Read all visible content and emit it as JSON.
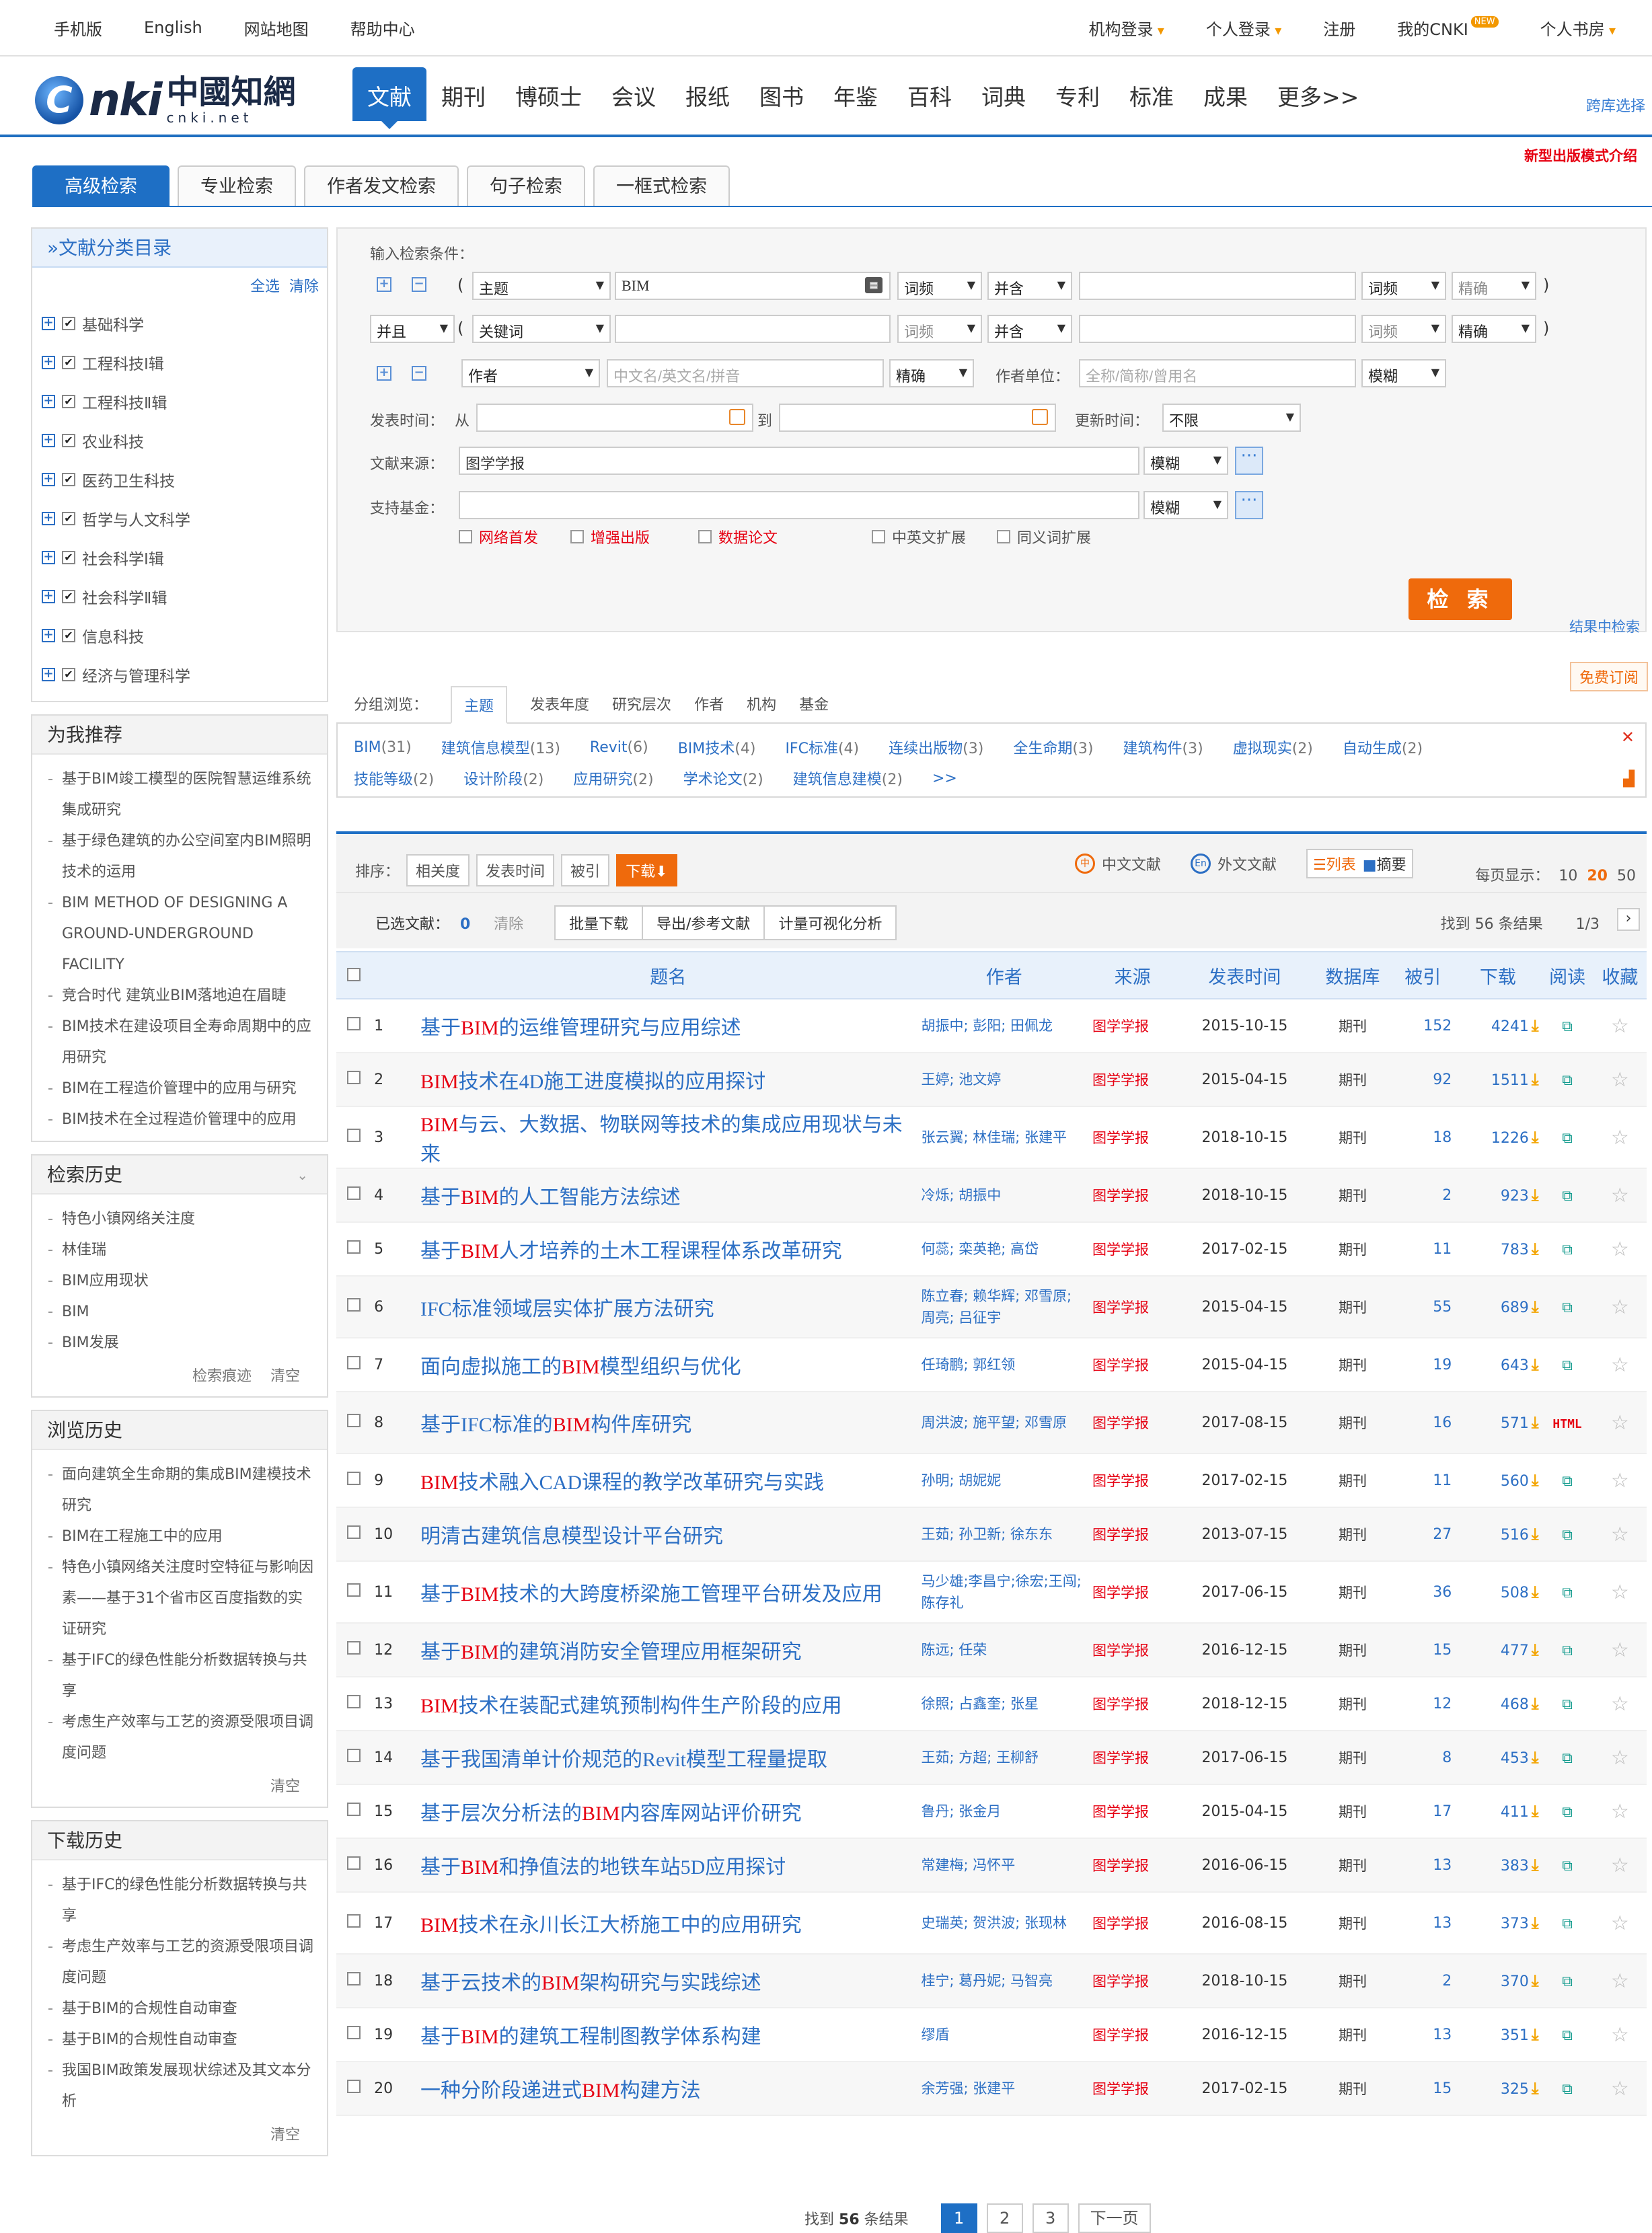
{
  "topbar": {
    "left": [
      "手机版",
      "English",
      "网站地图",
      "帮助中心"
    ],
    "right": [
      "机构登录",
      "个人登录",
      "注册",
      "我的CNKI",
      "个人书房"
    ],
    "new_badge": "NEW"
  },
  "logo": {
    "mark": "C",
    "text": "nki",
    "cn": "中國知網",
    "en": "cnki.net"
  },
  "nav": [
    "文献",
    "期刊",
    "博硕士",
    "会议",
    "报纸",
    "图书",
    "年鉴",
    "百科",
    "词典",
    "专利",
    "标准",
    "成果",
    "更多>>"
  ],
  "cross_select": "跨库选择",
  "new_pub": "新型出版模式介绍",
  "search_tabs": [
    "高级检索",
    "专业检索",
    "作者发文检索",
    "句子检索",
    "一框式检索"
  ],
  "sidebar": {
    "catalog_title": "»文献分类目录",
    "select_all": "全选",
    "clear": "清除",
    "categories": [
      "基础科学",
      "工程科技Ⅰ辑",
      "工程科技Ⅱ辑",
      "农业科技",
      "医药卫生科技",
      "哲学与人文科学",
      "社会科学Ⅰ辑",
      "社会科学Ⅱ辑",
      "信息科技",
      "经济与管理科学"
    ],
    "recommend_title": "为我推荐",
    "recommend": [
      "基于BIM竣工模型的医院智慧运维系统集成研究",
      "基于绿色建筑的办公空间室内BIM照明技术的运用",
      "BIM METHOD OF DESIGNING A GROUND-UNDERGROUND FACILITY",
      "竞合时代 建筑业BIM落地迫在眉睫",
      "BIM技术在建设项目全寿命周期中的应用研究",
      "BIM在工程造价管理中的应用与研究",
      "BIM技术在全过程造价管理中的应用"
    ],
    "search_history_title": "检索历史",
    "search_history": [
      "特色小镇网络关注度",
      "林佳瑞",
      "BIM应用现状",
      "BIM",
      "BIM发展"
    ],
    "search_history_trace": "检索痕迹",
    "search_history_clear": "清空",
    "browse_history_title": "浏览历史",
    "browse_history": [
      "面向建筑全生命期的集成BIM建模技术研究",
      "BIM在工程施工中的应用",
      "特色小镇网络关注度时空特征与影响因素——基于31个省市区百度指数的实证研究",
      "基于IFC的绿色性能分析数据转换与共享",
      "考虑生产效率与工艺的资源受限项目调度问题"
    ],
    "browse_history_clear": "清空",
    "download_history_title": "下载历史",
    "download_history": [
      "基于IFC的绿色性能分析数据转换与共享",
      "考虑生产效率与工艺的资源受限项目调度问题",
      "基于BIM的合规性自动审查",
      "基于BIM的合规性自动审查",
      "我国BIM政策发展现状综述及其文本分析"
    ],
    "download_history_clear": "清空"
  },
  "form": {
    "input_label": "输入检索条件：",
    "row1": {
      "field": "主题",
      "value": "BIM",
      "freq": "词频",
      "logic": "并含",
      "freq2": "词频",
      "match": "精确"
    },
    "row2": {
      "op": "并且",
      "field": "关键词",
      "freq": "词频",
      "logic": "并含",
      "freq2": "词频",
      "match": "精确"
    },
    "row3": {
      "field": "作者",
      "author_placeholder": "中文名/英文名/拼音",
      "match": "精确",
      "unit_label": "作者单位：",
      "unit_placeholder": "全称/简称/曾用名",
      "unit_match": "模糊"
    },
    "time_label": "发表时间：",
    "from": "从",
    "to": "到",
    "update_label": "更新时间：",
    "update_value": "不限",
    "source_label": "文献来源：",
    "source_value": "图学学报",
    "source_match": "模糊",
    "fund_label": "支持基金：",
    "fund_match": "模糊",
    "options": [
      "网络首发",
      "增强出版",
      "数据论文",
      "中英文扩展",
      "同义词扩展"
    ],
    "search_button": "检 索",
    "in_results": "结果中检索",
    "free_sub": "免费订阅",
    "paren_open": "(",
    "paren_close": ")",
    "dots": "···"
  },
  "group": {
    "label": "分组浏览：",
    "tabs": [
      "主题",
      "发表年度",
      "研究层次",
      "作者",
      "机构",
      "基金"
    ],
    "items": [
      {
        "name": "BIM",
        "count": "(31)"
      },
      {
        "name": "建筑信息模型",
        "count": "(13)"
      },
      {
        "name": "Revit",
        "count": "(6)"
      },
      {
        "name": "BIM技术",
        "count": "(4)"
      },
      {
        "name": "IFC标准",
        "count": "(4)"
      },
      {
        "name": "连续出版物",
        "count": "(3)"
      },
      {
        "name": "全生命期",
        "count": "(3)"
      },
      {
        "name": "建筑构件",
        "count": "(3)"
      },
      {
        "name": "虚拟现实",
        "count": "(2)"
      },
      {
        "name": "自动生成",
        "count": "(2)"
      },
      {
        "name": "技能等级",
        "count": "(2)"
      },
      {
        "name": "设计阶段",
        "count": "(2)"
      },
      {
        "name": "应用研究",
        "count": "(2)"
      },
      {
        "name": "学术论文",
        "count": "(2)"
      },
      {
        "name": "建筑信息建模",
        "count": "(2)"
      }
    ],
    "more": ">>",
    "close": "✕"
  },
  "results_bar": {
    "sort_label": "排序：",
    "sorts": [
      "相关度",
      "发表时间",
      "被引",
      "下载"
    ],
    "cn": "中文文献",
    "en": "外文文献",
    "view_list": "列表",
    "view_abstract": "摘要",
    "per_page_label": "每页显示：",
    "per_page": [
      "10",
      "20",
      "50"
    ],
    "selected_label": "已选文献：",
    "selected_count": "0",
    "clear": "清除",
    "ops": [
      "批量下载",
      "导出/参考文献",
      "计量可视化分析"
    ],
    "found": "找到 56 条结果",
    "page": "1/3",
    "next": "›"
  },
  "table": {
    "headers": [
      "题名",
      "作者",
      "来源",
      "发表时间",
      "数据库",
      "被引",
      "下载",
      "阅读",
      "收藏"
    ],
    "rows": [
      {
        "no": "1",
        "pre": "基于",
        "hl": "BIM",
        "post": "的运维管理研究与应用综述",
        "authors": "胡振中; 彭阳; 田佩龙",
        "source": "图学学报",
        "date": "2015-10-15",
        "db": "期刊",
        "cited": "152",
        "dl": "4241"
      },
      {
        "no": "2",
        "pre": "",
        "hl": "BIM",
        "post": "技术在4D施工进度模拟的应用探讨",
        "authors": "王婷; 池文婷",
        "source": "图学学报",
        "date": "2015-04-15",
        "db": "期刊",
        "cited": "92",
        "dl": "1511"
      },
      {
        "no": "3",
        "pre": "",
        "hl": "BIM",
        "post": "与云、大数据、物联网等技术的集成应用现状与未来",
        "authors": "张云翼; 林佳瑞; 张建平",
        "source": "图学学报",
        "date": "2018-10-15",
        "db": "期刊",
        "cited": "18",
        "dl": "1226"
      },
      {
        "no": "4",
        "pre": "基于",
        "hl": "BIM",
        "post": "的人工智能方法综述",
        "authors": "冷烁; 胡振中",
        "source": "图学学报",
        "date": "2018-10-15",
        "db": "期刊",
        "cited": "2",
        "dl": "923"
      },
      {
        "no": "5",
        "pre": "基于",
        "hl": "BIM",
        "post": "人才培养的土木工程课程体系改革研究",
        "authors": "何蕊; 栾英艳; 高岱",
        "source": "图学学报",
        "date": "2017-02-15",
        "db": "期刊",
        "cited": "11",
        "dl": "783"
      },
      {
        "no": "6",
        "pre": "IFC标准领域层实体扩展方法研究",
        "hl": "",
        "post": "",
        "authors": "陈立春; 赖华辉; 邓雪原; 周亮; 吕征宇",
        "source": "图学学报",
        "date": "2015-04-15",
        "db": "期刊",
        "cited": "55",
        "dl": "689"
      },
      {
        "no": "7",
        "pre": "面向虚拟施工的",
        "hl": "BIM",
        "post": "模型组织与优化",
        "authors": "任琦鹏; 郭红领",
        "source": "图学学报",
        "date": "2015-04-15",
        "db": "期刊",
        "cited": "19",
        "dl": "643"
      },
      {
        "no": "8",
        "pre": "基于IFC标准的",
        "hl": "BIM",
        "post": "构件库研究",
        "authors": "周洪波; 施平望; 邓雪原",
        "source": "图学学报",
        "date": "2017-08-15",
        "db": "期刊",
        "cited": "16",
        "dl": "571",
        "html": "HTML"
      },
      {
        "no": "9",
        "pre": "",
        "hl": "BIM",
        "post": "技术融入CAD课程的教学改革研究与实践",
        "authors": "孙明; 胡妮妮",
        "source": "图学学报",
        "date": "2017-02-15",
        "db": "期刊",
        "cited": "11",
        "dl": "560"
      },
      {
        "no": "10",
        "pre": "明清古建筑信息模型设计平台研究",
        "hl": "",
        "post": "",
        "authors": "王茹; 孙卫新; 徐东东",
        "source": "图学学报",
        "date": "2013-07-15",
        "db": "期刊",
        "cited": "27",
        "dl": "516"
      },
      {
        "no": "11",
        "pre": "基于",
        "hl": "BIM",
        "post": "技术的大跨度桥梁施工管理平台研发及应用",
        "authors": "马少雄;李昌宁;徐宏;王闯;陈存礼",
        "source": "图学学报",
        "date": "2017-06-15",
        "db": "期刊",
        "cited": "36",
        "dl": "508"
      },
      {
        "no": "12",
        "pre": "基于",
        "hl": "BIM",
        "post": "的建筑消防安全管理应用框架研究",
        "authors": "陈远; 任荣",
        "source": "图学学报",
        "date": "2016-12-15",
        "db": "期刊",
        "cited": "15",
        "dl": "477"
      },
      {
        "no": "13",
        "pre": "",
        "hl": "BIM",
        "post": "技术在装配式建筑预制构件生产阶段的应用",
        "authors": "徐照; 占鑫奎; 张星",
        "source": "图学学报",
        "date": "2018-12-15",
        "db": "期刊",
        "cited": "12",
        "dl": "468"
      },
      {
        "no": "14",
        "pre": "基于我国清单计价规范的Revit模型工程量提取",
        "hl": "",
        "post": "",
        "authors": "王茹; 方超; 王柳舒",
        "source": "图学学报",
        "date": "2017-06-15",
        "db": "期刊",
        "cited": "8",
        "dl": "453"
      },
      {
        "no": "15",
        "pre": "基于层次分析法的",
        "hl": "BIM",
        "post": "内容库网站评价研究",
        "authors": "鲁丹; 张金月",
        "source": "图学学报",
        "date": "2015-04-15",
        "db": "期刊",
        "cited": "17",
        "dl": "411"
      },
      {
        "no": "16",
        "pre": "基于",
        "hl": "BIM",
        "post": "和挣值法的地铁车站5D应用探讨",
        "authors": "常建梅; 冯怀平",
        "source": "图学学报",
        "date": "2016-06-15",
        "db": "期刊",
        "cited": "13",
        "dl": "383"
      },
      {
        "no": "17",
        "pre": "",
        "hl": "BIM",
        "post": "技术在永川长江大桥施工中的应用研究",
        "authors": "史瑞英; 贺洪波; 张现林",
        "source": "图学学报",
        "date": "2016-08-15",
        "db": "期刊",
        "cited": "13",
        "dl": "373"
      },
      {
        "no": "18",
        "pre": "基于云技术的",
        "hl": "BIM",
        "post": "架构研究与实践综述",
        "authors": "桂宁; 葛丹妮; 马智亮",
        "source": "图学学报",
        "date": "2018-10-15",
        "db": "期刊",
        "cited": "2",
        "dl": "370"
      },
      {
        "no": "19",
        "pre": "基于",
        "hl": "BIM",
        "post": "的建筑工程制图教学体系构建",
        "authors": "缪盾",
        "source": "图学学报",
        "date": "2016-12-15",
        "db": "期刊",
        "cited": "13",
        "dl": "351"
      },
      {
        "no": "20",
        "pre": "一种分阶段递进式",
        "hl": "BIM",
        "post": "构建方法",
        "authors": "余芳强; 张建平",
        "source": "图学学报",
        "date": "2017-02-15",
        "db": "期刊",
        "cited": "15",
        "dl": "325"
      }
    ]
  },
  "pager": {
    "found_pre": "找到",
    "found_num": "56",
    "found_post": "条结果",
    "pages": [
      "1",
      "2",
      "3"
    ],
    "next": "下一页"
  }
}
